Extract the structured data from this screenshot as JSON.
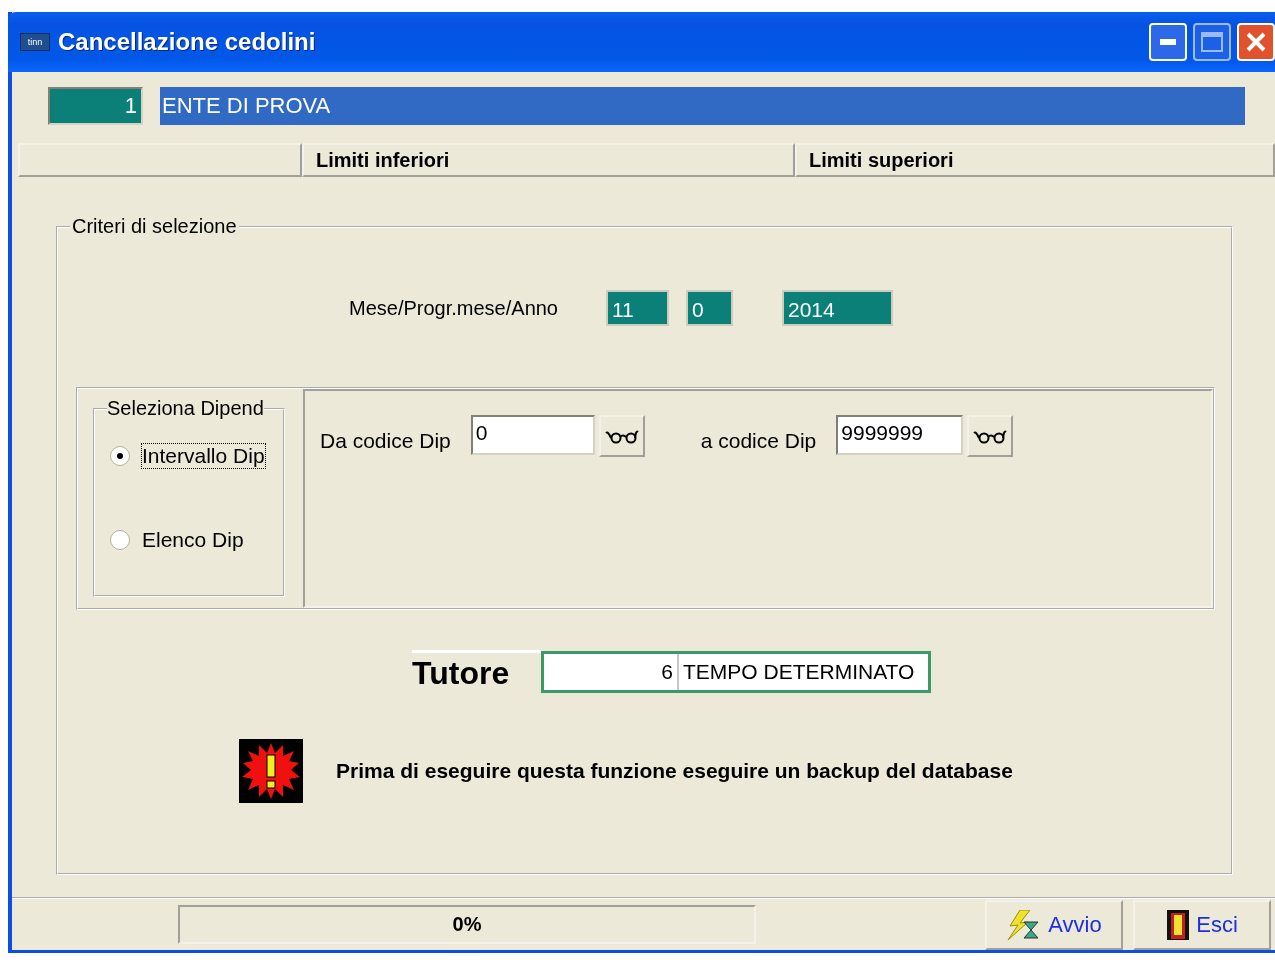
{
  "window": {
    "title": "Cancellazione cedolini",
    "app_icon_label": "tinn"
  },
  "ente": {
    "code": "1",
    "name": "ENTE DI PROVA"
  },
  "columns": [
    {
      "label": "Limiti inferiori"
    },
    {
      "label": "Limiti superiori"
    }
  ],
  "criteria": {
    "legend": "Criteri di selezione",
    "period": {
      "label": "Mese/Progr.mese/Anno",
      "month": "11",
      "progressive": "0",
      "year": "2014"
    },
    "selection": {
      "legend": "Seleziona Dipend",
      "options": [
        {
          "label": "Intervallo Dip",
          "selected": true,
          "focused": true
        },
        {
          "label": "Elenco Dip",
          "selected": false,
          "focused": false
        }
      ]
    },
    "range": {
      "from_label": "Da codice Dip",
      "from_value": "0",
      "to_label": "a codice Dip",
      "to_value": "9999999"
    },
    "tutor": {
      "label": "Tutore",
      "code": "6",
      "description": "TEMPO DETERMINATO"
    },
    "warning": "Prima di eseguire questa funzione eseguire un backup del database"
  },
  "status_bar": {
    "progress": {
      "level": 0,
      "reading": "0%"
    },
    "buttons": [
      {
        "label": "Avvio",
        "kind": "start"
      },
      {
        "label": "Esci",
        "kind": "exit"
      }
    ]
  }
}
